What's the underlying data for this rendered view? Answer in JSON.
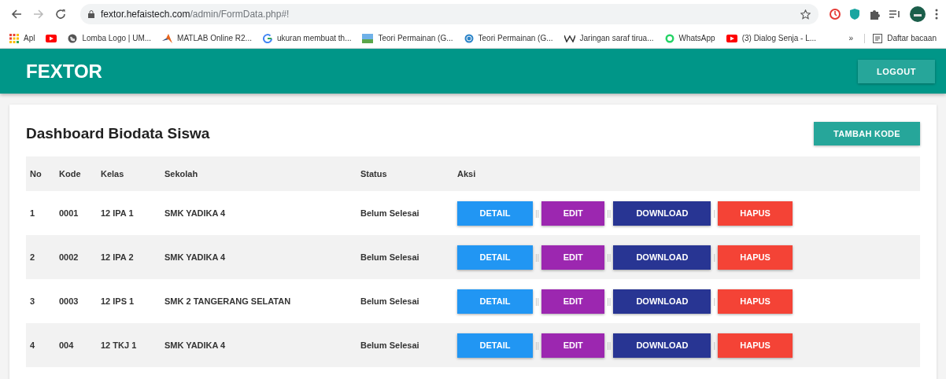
{
  "browser": {
    "url_host": "fextor.hefaistech.com",
    "url_path": "/admin/FormData.php#!",
    "bookmarks": [
      {
        "kind": "link",
        "label": "Apl"
      },
      {
        "kind": "icon"
      },
      {
        "kind": "link",
        "label": "Lomba Logo | UM..."
      },
      {
        "kind": "link",
        "label": "MATLAB Online R2..."
      },
      {
        "kind": "link",
        "label": "ukuran membuat th..."
      },
      {
        "kind": "link",
        "label": "Teori Permainan (G..."
      },
      {
        "kind": "link",
        "label": "Teori Permainan (G..."
      },
      {
        "kind": "link",
        "label": "Jaringan saraf tirua..."
      },
      {
        "kind": "link",
        "label": "WhatsApp"
      },
      {
        "kind": "link",
        "label": "(3) Dialog Senja - L..."
      }
    ],
    "more": "»",
    "reading_list": "Daftar bacaan"
  },
  "header": {
    "brand": "FEXTOR",
    "logout": "LOGOUT"
  },
  "card": {
    "title": "Dashboard Biodata Siswa",
    "add_button": "TAMBAH KODE"
  },
  "table": {
    "columns": [
      "No",
      "Kode",
      "Kelas",
      "Sekolah",
      "Status",
      "Aksi"
    ],
    "rows": [
      {
        "no": "1",
        "kode": "0001",
        "kelas": "12 IPA 1",
        "sekolah": "SMK YADIKA 4",
        "status": "Belum Selesai",
        "actions": [
          {
            "label": "DETAIL",
            "color": "#2196f3",
            "separator": "||"
          },
          {
            "label": "EDIT",
            "color": "#9c27b0",
            "separator": "||"
          },
          {
            "label": "DOWNLOAD",
            "color": "#283593",
            "separator": "|"
          },
          {
            "label": "HAPUS",
            "color": "#f44336"
          }
        ]
      },
      {
        "no": "2",
        "kode": "0002",
        "kelas": "12 IPA 2",
        "sekolah": "SMK YADIKA 4",
        "status": "Belum Selesai",
        "actions": [
          {
            "label": "DETAIL",
            "color": "#2196f3",
            "separator": "||"
          },
          {
            "label": "EDIT",
            "color": "#9c27b0",
            "separator": "||"
          },
          {
            "label": "DOWNLOAD",
            "color": "#283593",
            "separator": "|"
          },
          {
            "label": "HAPUS",
            "color": "#f44336"
          }
        ]
      },
      {
        "no": "3",
        "kode": "0003",
        "kelas": "12 IPS 1",
        "sekolah": "SMK 2 TANGERANG SELATAN",
        "status": "Belum Selesai",
        "actions": [
          {
            "label": "DETAIL",
            "color": "#2196f3",
            "separator": "||"
          },
          {
            "label": "EDIT",
            "color": "#9c27b0",
            "separator": "||"
          },
          {
            "label": "DOWNLOAD",
            "color": "#283593",
            "separator": "|"
          },
          {
            "label": "HAPUS",
            "color": "#f44336"
          }
        ]
      },
      {
        "no": "4",
        "kode": "004",
        "kelas": "12 TKJ 1",
        "sekolah": "SMK YADIKA 4",
        "status": "Belum Selesai",
        "actions": [
          {
            "label": "DETAIL",
            "color": "#2196f3",
            "separator": "||"
          },
          {
            "label": "EDIT",
            "color": "#9c27b0",
            "separator": "||"
          },
          {
            "label": "DOWNLOAD",
            "color": "#283593",
            "separator": "|"
          },
          {
            "label": "HAPUS",
            "color": "#f44336"
          }
        ]
      }
    ]
  }
}
